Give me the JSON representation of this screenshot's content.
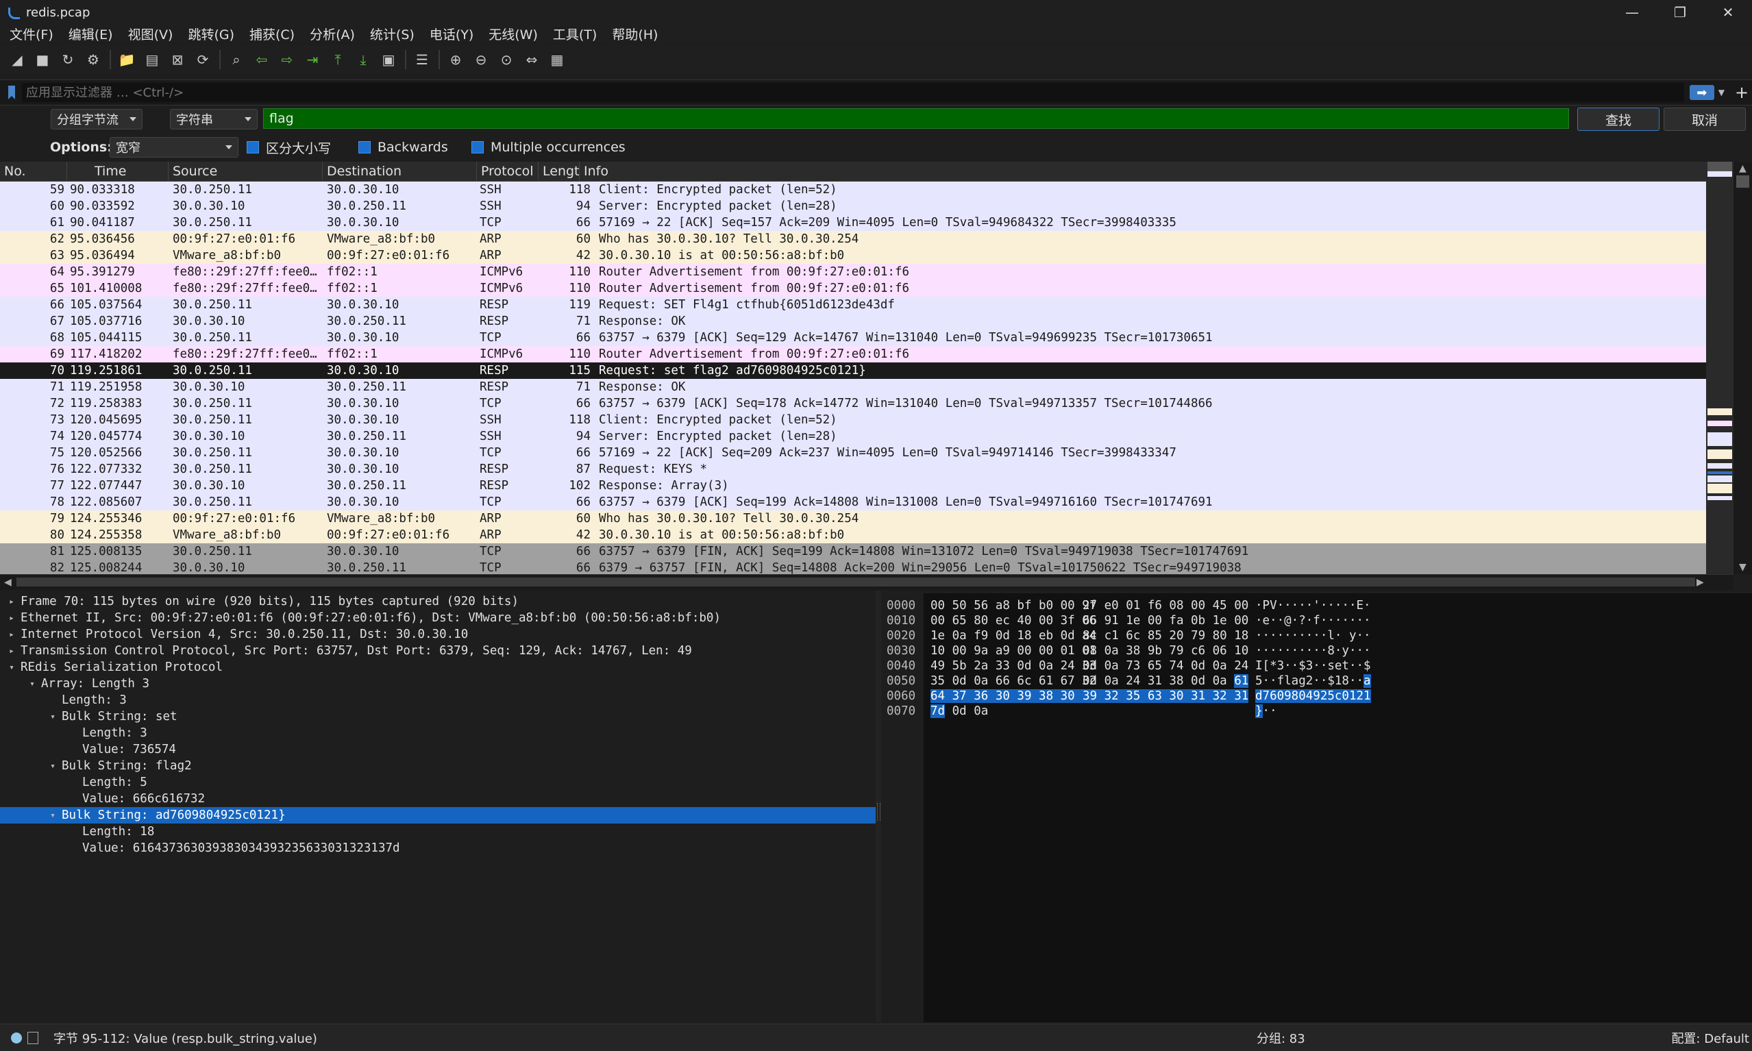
{
  "window": {
    "title": "redis.pcap",
    "controls": [
      "—",
      "❐",
      "✕"
    ]
  },
  "menu": [
    "文件(F)",
    "编辑(E)",
    "视图(V)",
    "跳转(G)",
    "捕获(C)",
    "分析(A)",
    "统计(S)",
    "电话(Y)",
    "无线(W)",
    "工具(T)",
    "帮助(H)"
  ],
  "toolbar": [
    "shark-fin-start-icon",
    "stop-icon",
    "restart-icon",
    "capture-options-icon",
    "separator",
    "open-folder-icon",
    "save-icon",
    "close-file-icon",
    "reload-icon",
    "separator",
    "find-icon",
    "back-arrow-icon",
    "forward-arrow-icon",
    "go-to-packet-icon",
    "first-packet-icon",
    "last-packet-icon",
    "autoscroll-icon",
    "separator",
    "colorize-icon",
    "separator",
    "zoom-in-icon",
    "zoom-out-icon",
    "zoom-normal-icon",
    "resize-columns-icon",
    "layout-icon"
  ],
  "filter": {
    "placeholder": "应用显示过滤器 … <Ctrl-/>"
  },
  "find": {
    "scope": "分组字节流",
    "type": "字符串",
    "value": "flag",
    "find_label": "查找",
    "cancel_label": "取消"
  },
  "options": {
    "label": "Options:",
    "charset": "宽窄",
    "case_label": "区分大小写",
    "backwards_label": "Backwards",
    "multiple_label": "Multiple occurrences"
  },
  "columns": [
    "No.",
    "Time",
    "Source",
    "Destination",
    "Protocol",
    "Length",
    "Info"
  ],
  "colors": {
    "ssh": "#e7e6ff",
    "tcp": "#e7e6ff",
    "arp": "#faf0d7",
    "icmpv6": "#fce0ff",
    "selected": "#1a1a1a",
    "fin": "#a0a0a0",
    "find_green": "#006400",
    "highlight_blue": "#1565c0"
  },
  "packets": [
    {
      "no": "59",
      "time": "90.033318",
      "src": "30.0.250.11",
      "dst": "30.0.30.10",
      "proto": "SSH",
      "len": "118",
      "info": "Client: Encrypted packet (len=52)",
      "color": "#e7e6ff"
    },
    {
      "no": "60",
      "time": "90.033592",
      "src": "30.0.30.10",
      "dst": "30.0.250.11",
      "proto": "SSH",
      "len": "94",
      "info": "Server: Encrypted packet (len=28)",
      "color": "#e7e6ff"
    },
    {
      "no": "61",
      "time": "90.041187",
      "src": "30.0.250.11",
      "dst": "30.0.30.10",
      "proto": "TCP",
      "len": "66",
      "info": "57169 → 22 [ACK] Seq=157 Ack=209 Win=4095 Len=0 TSval=949684322 TSecr=3998403335",
      "color": "#e7e6ff"
    },
    {
      "no": "62",
      "time": "95.036456",
      "src": "00:9f:27:e0:01:f6",
      "dst": "VMware_a8:bf:b0",
      "proto": "ARP",
      "len": "60",
      "info": "Who has 30.0.30.10? Tell 30.0.30.254",
      "color": "#faf0d7"
    },
    {
      "no": "63",
      "time": "95.036494",
      "src": "VMware_a8:bf:b0",
      "dst": "00:9f:27:e0:01:f6",
      "proto": "ARP",
      "len": "42",
      "info": "30.0.30.10 is at 00:50:56:a8:bf:b0",
      "color": "#faf0d7"
    },
    {
      "no": "64",
      "time": "95.391279",
      "src": "fe80::29f:27ff:fee0…",
      "dst": "ff02::1",
      "proto": "ICMPv6",
      "len": "110",
      "info": "Router Advertisement from 00:9f:27:e0:01:f6",
      "color": "#fce0ff"
    },
    {
      "no": "65",
      "time": "101.410008",
      "src": "fe80::29f:27ff:fee0…",
      "dst": "ff02::1",
      "proto": "ICMPv6",
      "len": "110",
      "info": "Router Advertisement from 00:9f:27:e0:01:f6",
      "color": "#fce0ff"
    },
    {
      "no": "66",
      "time": "105.037564",
      "src": "30.0.250.11",
      "dst": "30.0.30.10",
      "proto": "RESP",
      "len": "119",
      "info": "Request: SET Fl4g1 ctfhub{6051d6123de43df",
      "color": "#e7e6ff"
    },
    {
      "no": "67",
      "time": "105.037716",
      "src": "30.0.30.10",
      "dst": "30.0.250.11",
      "proto": "RESP",
      "len": "71",
      "info": "Response: OK",
      "color": "#e7e6ff"
    },
    {
      "no": "68",
      "time": "105.044115",
      "src": "30.0.250.11",
      "dst": "30.0.30.10",
      "proto": "TCP",
      "len": "66",
      "info": "63757 → 6379 [ACK] Seq=129 Ack=14767 Win=131040 Len=0 TSval=949699235 TSecr=101730651",
      "color": "#e7e6ff"
    },
    {
      "no": "69",
      "time": "117.418202",
      "src": "fe80::29f:27ff:fee0…",
      "dst": "ff02::1",
      "proto": "ICMPv6",
      "len": "110",
      "info": "Router Advertisement from 00:9f:27:e0:01:f6",
      "color": "#fce0ff"
    },
    {
      "no": "70",
      "time": "119.251861",
      "src": "30.0.250.11",
      "dst": "30.0.30.10",
      "proto": "RESP",
      "len": "115",
      "info": "Request: set flag2 ad7609804925c0121}",
      "color": "#1a1a1a",
      "selected": true
    },
    {
      "no": "71",
      "time": "119.251958",
      "src": "30.0.30.10",
      "dst": "30.0.250.11",
      "proto": "RESP",
      "len": "71",
      "info": "Response: OK",
      "color": "#e7e6ff"
    },
    {
      "no": "72",
      "time": "119.258383",
      "src": "30.0.250.11",
      "dst": "30.0.30.10",
      "proto": "TCP",
      "len": "66",
      "info": "63757 → 6379 [ACK] Seq=178 Ack=14772 Win=131040 Len=0 TSval=949713357 TSecr=101744866",
      "color": "#e7e6ff"
    },
    {
      "no": "73",
      "time": "120.045695",
      "src": "30.0.250.11",
      "dst": "30.0.30.10",
      "proto": "SSH",
      "len": "118",
      "info": "Client: Encrypted packet (len=52)",
      "color": "#e7e6ff"
    },
    {
      "no": "74",
      "time": "120.045774",
      "src": "30.0.30.10",
      "dst": "30.0.250.11",
      "proto": "SSH",
      "len": "94",
      "info": "Server: Encrypted packet (len=28)",
      "color": "#e7e6ff"
    },
    {
      "no": "75",
      "time": "120.052566",
      "src": "30.0.250.11",
      "dst": "30.0.30.10",
      "proto": "TCP",
      "len": "66",
      "info": "57169 → 22 [ACK] Seq=209 Ack=237 Win=4095 Len=0 TSval=949714146 TSecr=3998433347",
      "color": "#e7e6ff"
    },
    {
      "no": "76",
      "time": "122.077332",
      "src": "30.0.250.11",
      "dst": "30.0.30.10",
      "proto": "RESP",
      "len": "87",
      "info": "Request: KEYS *",
      "color": "#e7e6ff"
    },
    {
      "no": "77",
      "time": "122.077447",
      "src": "30.0.30.10",
      "dst": "30.0.250.11",
      "proto": "RESP",
      "len": "102",
      "info": "Response: Array(3)",
      "color": "#e7e6ff"
    },
    {
      "no": "78",
      "time": "122.085607",
      "src": "30.0.250.11",
      "dst": "30.0.30.10",
      "proto": "TCP",
      "len": "66",
      "info": "63757 → 6379 [ACK] Seq=199 Ack=14808 Win=131008 Len=0 TSval=949716160 TSecr=101747691",
      "color": "#e7e6ff"
    },
    {
      "no": "79",
      "time": "124.255346",
      "src": "00:9f:27:e0:01:f6",
      "dst": "VMware_a8:bf:b0",
      "proto": "ARP",
      "len": "60",
      "info": "Who has 30.0.30.10? Tell 30.0.30.254",
      "color": "#faf0d7"
    },
    {
      "no": "80",
      "time": "124.255358",
      "src": "VMware_a8:bf:b0",
      "dst": "00:9f:27:e0:01:f6",
      "proto": "ARP",
      "len": "42",
      "info": "30.0.30.10 is at 00:50:56:a8:bf:b0",
      "color": "#faf0d7"
    },
    {
      "no": "81",
      "time": "125.008135",
      "src": "30.0.250.11",
      "dst": "30.0.30.10",
      "proto": "TCP",
      "len": "66",
      "info": "63757 → 6379 [FIN, ACK] Seq=199 Ack=14808 Win=131072 Len=0 TSval=949719038 TSecr=101747691",
      "color": "#a0a0a0"
    },
    {
      "no": "82",
      "time": "125.008244",
      "src": "30.0.30.10",
      "dst": "30.0.250.11",
      "proto": "TCP",
      "len": "66",
      "info": "6379 → 63757 [FIN, ACK] Seq=14808 Ack=200 Win=29056 Len=0 TSval=101750622 TSecr=949719038",
      "color": "#a0a0a0"
    }
  ],
  "details": [
    {
      "arrow": "▸",
      "indent": 0,
      "text": "Frame 70: 115 bytes on wire (920 bits), 115 bytes captured (920 bits)"
    },
    {
      "arrow": "▸",
      "indent": 0,
      "text": "Ethernet II, Src: 00:9f:27:e0:01:f6 (00:9f:27:e0:01:f6), Dst: VMware_a8:bf:b0 (00:50:56:a8:bf:b0)"
    },
    {
      "arrow": "▸",
      "indent": 0,
      "text": "Internet Protocol Version 4, Src: 30.0.250.11, Dst: 30.0.30.10"
    },
    {
      "arrow": "▸",
      "indent": 0,
      "text": "Transmission Control Protocol, Src Port: 63757, Dst Port: 6379, Seq: 129, Ack: 14767, Len: 49"
    },
    {
      "arrow": "▾",
      "indent": 0,
      "text": "REdis Serialization Protocol"
    },
    {
      "arrow": "▾",
      "indent": 1,
      "text": "Array: Length 3"
    },
    {
      "arrow": "",
      "indent": 2,
      "text": "Length: 3"
    },
    {
      "arrow": "▾",
      "indent": 2,
      "text": "Bulk String: set"
    },
    {
      "arrow": "",
      "indent": 3,
      "text": "Length: 3"
    },
    {
      "arrow": "",
      "indent": 3,
      "text": "Value: 736574"
    },
    {
      "arrow": "▾",
      "indent": 2,
      "text": "Bulk String: flag2"
    },
    {
      "arrow": "",
      "indent": 3,
      "text": "Length: 5"
    },
    {
      "arrow": "",
      "indent": 3,
      "text": "Value: 666c616732"
    },
    {
      "arrow": "▾",
      "indent": 2,
      "text": "Bulk String: ad7609804925c0121}",
      "selected": true
    },
    {
      "arrow": "",
      "indent": 3,
      "text": "Length: 18"
    },
    {
      "arrow": "",
      "indent": 3,
      "text": "Value: 616437363039383034393235633031323137d"
    }
  ],
  "bytes": [
    {
      "offset": "0000",
      "hex": [
        "00 50 56 a8 bf b0 00 9f",
        "27 e0 01 f6 08 00 45 00"
      ],
      "ascii": "·PV·····'·····E·"
    },
    {
      "offset": "0010",
      "hex": [
        "00 65 80 ec 40 00 3f 06",
        "66 91 1e 00 fa 0b 1e 00"
      ],
      "ascii": "·e··@·?·f·······"
    },
    {
      "offset": "0020",
      "hex": [
        "1e 0a f9 0d 18 eb 0d a4",
        "8c c1 6c 85 20 79 80 18"
      ],
      "ascii": "··········l· y··"
    },
    {
      "offset": "0030",
      "hex": [
        "10 00 9a a9 00 00 01 01",
        "08 0a 38 9b 79 c6 06 10"
      ],
      "ascii": "··········8·y···"
    },
    {
      "offset": "0040",
      "hex": [
        "49 5b 2a 33 0d 0a 24 33",
        "0d 0a 73 65 74 0d 0a 24"
      ],
      "ascii": "I[*3··$3··set··$"
    },
    {
      "offset": "0050",
      "hex": [
        "35 0d 0a 66 6c 61 67 32",
        "0d 0a 24 31 38 0d 0a 61"
      ],
      "ascii": "5··flag2··$18··a"
    },
    {
      "offset": "0060",
      "hex": [
        "64 37 36 30 39 38 30 34",
        "39 32 35 63 30 31 32 31"
      ],
      "ascii": "d7609804925c0121"
    },
    {
      "offset": "0070",
      "hex": [
        "7d 0d 0a",
        ""
      ],
      "ascii": "}··"
    }
  ],
  "status": {
    "field": "字节 95-112: Value (resp.bulk_string.value)",
    "packets": "分组: 83",
    "profile": "配置: Default"
  }
}
